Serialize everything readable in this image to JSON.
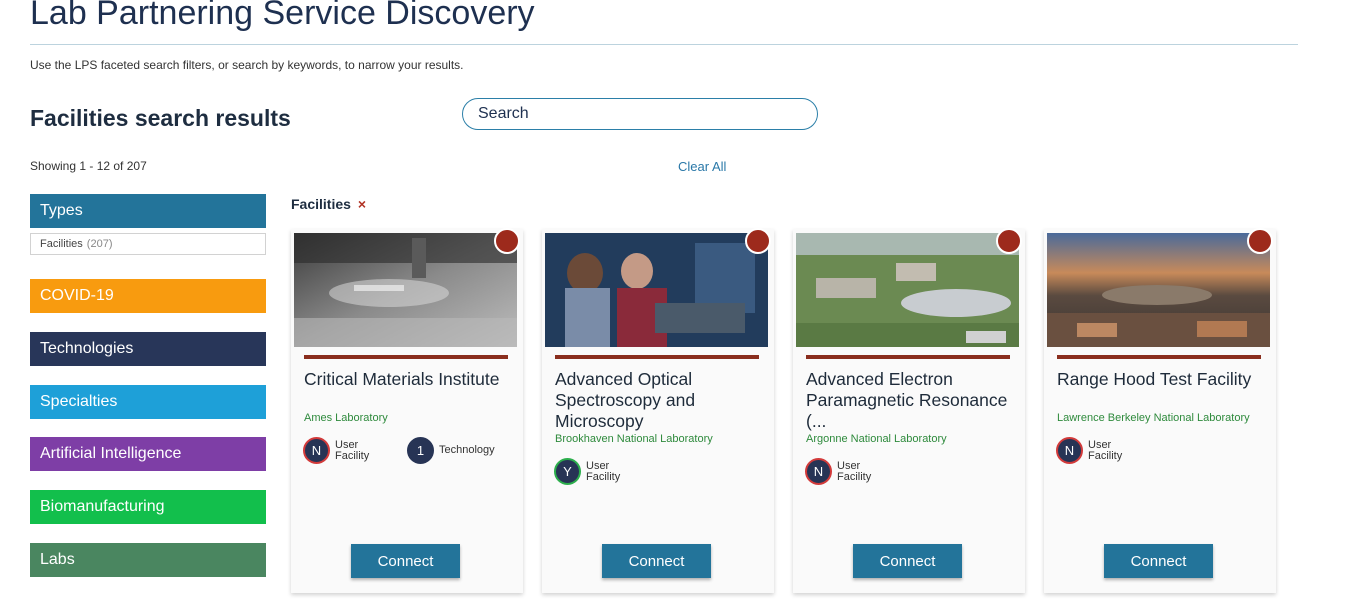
{
  "page": {
    "title": "Lab Partnering Service Discovery",
    "intro": "Use the LPS faceted search filters, or search by keywords, to narrow your results."
  },
  "results": {
    "heading": "Facilities search results",
    "showing": "Showing 1 - 12 of 207",
    "clear_all": "Clear All"
  },
  "search": {
    "placeholder": "Search"
  },
  "facets": {
    "types": {
      "label": "Types",
      "option_label": "Facilities",
      "option_count": "(207)"
    },
    "covid": "COVID-19",
    "technologies": "Technologies",
    "specialties": "Specialties",
    "ai": "Artificial Intelligence",
    "biomanufacturing": "Biomanufacturing",
    "labs": "Labs"
  },
  "active_filter": {
    "label": "Facilities",
    "remove_icon": "×"
  },
  "cards": [
    {
      "title": "Critical Materials Institute",
      "lab": "Ames Laboratory",
      "badges": [
        {
          "letter": "N",
          "label": "User Facility"
        },
        {
          "letter": "1",
          "label": "Technology"
        }
      ],
      "connect": "Connect"
    },
    {
      "title": "Advanced Optical Spectroscopy and Microscopy",
      "lab": "Brookhaven National Laboratory",
      "badges": [
        {
          "letter": "Y",
          "label": "User Facility"
        }
      ],
      "connect": "Connect"
    },
    {
      "title": "Advanced Electron Paramagnetic Resonance (...",
      "lab": "Argonne National Laboratory",
      "badges": [
        {
          "letter": "N",
          "label": "User Facility"
        }
      ],
      "connect": "Connect"
    },
    {
      "title": "Range Hood Test Facility",
      "lab": "Lawrence Berkeley National Laboratory",
      "badges": [
        {
          "letter": "N",
          "label": "User Facility"
        }
      ],
      "connect": "Connect"
    }
  ],
  "colors": {
    "primary_blue": "#23749a",
    "covid_orange": "#f89b0f",
    "tech_navy": "#283659",
    "spec_blue": "#1ea0d8",
    "ai_purple": "#7e3ea6",
    "bio_green": "#12bf4c",
    "labs_green": "#4a8660",
    "card_accent": "#8a2e1e",
    "lab_text_green": "#2e8a3c"
  }
}
